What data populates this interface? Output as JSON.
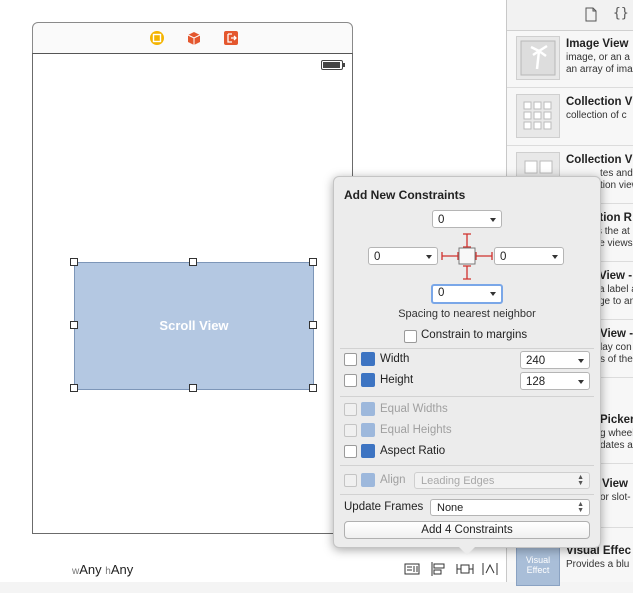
{
  "scene": {
    "scroll_view_label": "Scroll View",
    "icons": [
      "view-controller-icon",
      "first-responder-icon",
      "exit-icon"
    ]
  },
  "size_class": {
    "w_prefix": "w",
    "w_value": "Any",
    "h_prefix": "h",
    "h_value": "Any"
  },
  "bottom_toolbar": {
    "icons": [
      "stack-icon",
      "align-icon",
      "pin-icon",
      "resolve-icon"
    ]
  },
  "library": {
    "header_icons": [
      "file-icon",
      "braces-icon"
    ],
    "items": [
      {
        "title": "Image View",
        "desc1": "image, or an a",
        "desc2": "an array of ima"
      },
      {
        "title": "Collection Vi",
        "desc1": "collection of c",
        "desc2": ""
      },
      {
        "title": "Collection V",
        "desc1": "tes and",
        "desc2": "tion view"
      },
      {
        "title": "ction R",
        "desc1": "s the at",
        "desc2": "le views"
      },
      {
        "title": "View -",
        "desc1": "a label an",
        "desc2": "ge to an"
      },
      {
        "title": "View -",
        "desc1": "lay con",
        "desc2": "s of the"
      },
      {
        "title": "Picker",
        "desc1": "g wheel",
        "desc2": "dates a"
      },
      {
        "title": "View",
        "desc1": "or slot-",
        "desc2": ""
      },
      {
        "title": "Visual Effec",
        "desc1": "Provides a blu",
        "desc2": "",
        "thumb_text": "Visual Effect"
      }
    ]
  },
  "constraints_popover": {
    "title": "Add New Constraints",
    "top_value": "0",
    "left_value": "0",
    "right_value": "0",
    "bottom_value": "0",
    "spacing_label": "Spacing to nearest neighbor",
    "constrain_margins_label": "Constrain to margins",
    "width_label": "Width",
    "width_value": "240",
    "height_label": "Height",
    "height_value": "128",
    "equal_widths_label": "Equal Widths",
    "equal_heights_label": "Equal Heights",
    "aspect_ratio_label": "Aspect Ratio",
    "align_label": "Align",
    "align_value": "Leading Edges",
    "update_frames_label": "Update Frames",
    "update_frames_value": "None",
    "add_button_label": "Add 4 Constraints"
  },
  "colors": {
    "accent": "#3d74c2",
    "scroll_view_fill": "#b4c8e2",
    "strut_red": "#d0312d"
  }
}
